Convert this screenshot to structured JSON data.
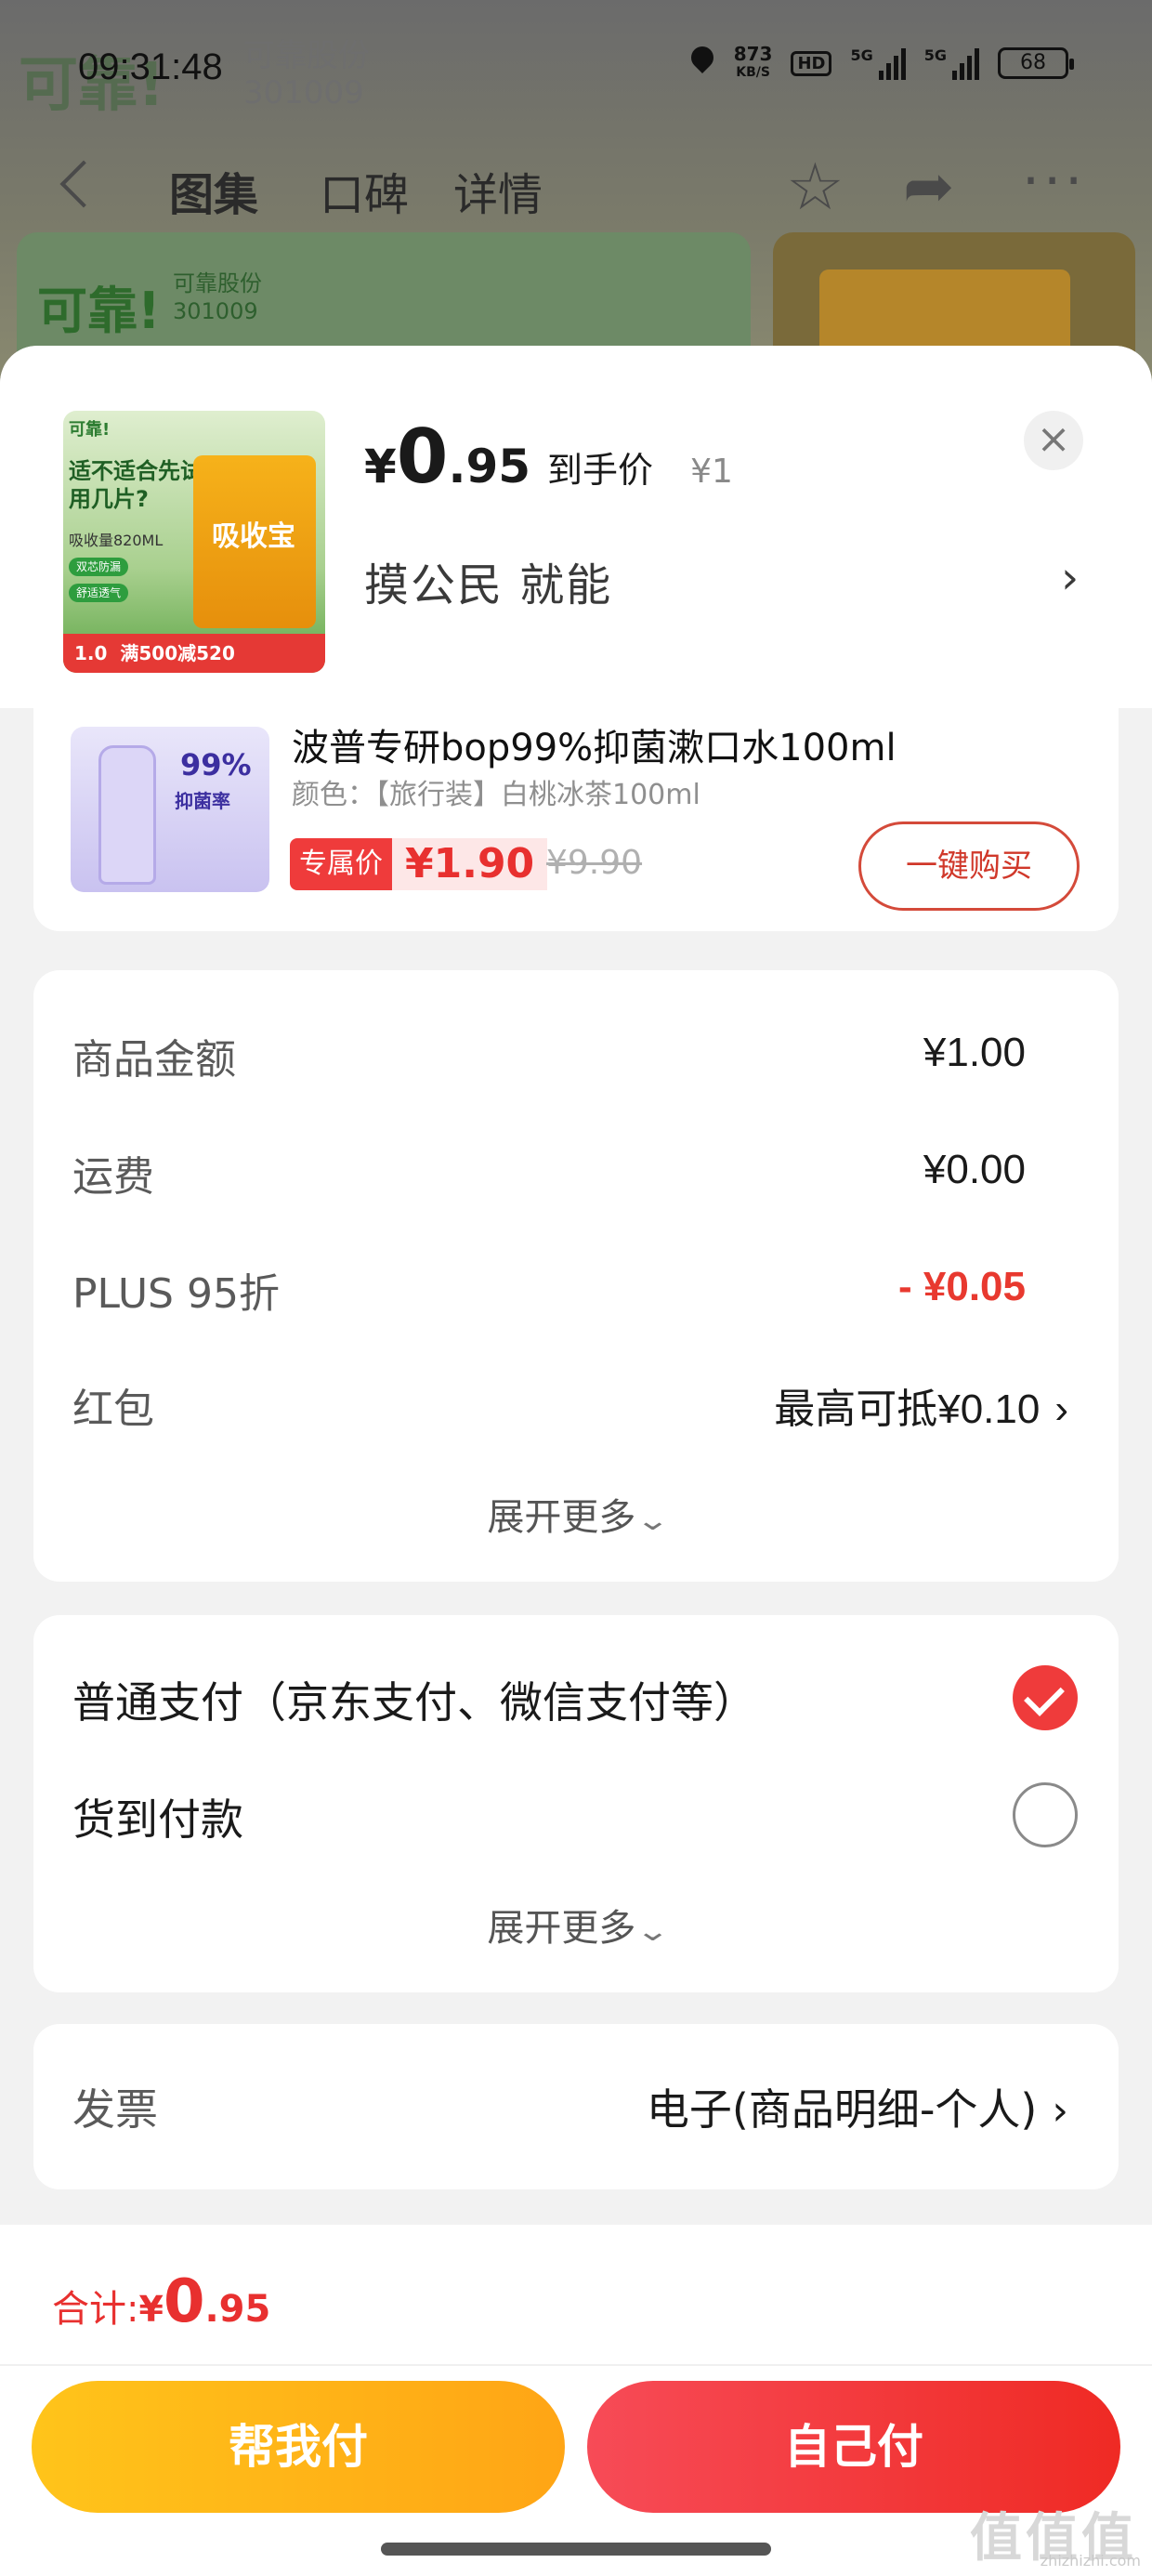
{
  "status_bar": {
    "time": "09:31:48",
    "net_speed_value": "873",
    "net_speed_unit": "KB/S",
    "hd": "HD",
    "signal_1": "5G",
    "signal_2": "5G",
    "battery": "68"
  },
  "background": {
    "brand_logo": "可靠!",
    "brand_name": "可靠股份",
    "brand_code": "301009"
  },
  "nav": {
    "tabs": [
      {
        "label": "图集",
        "active": true
      },
      {
        "label": "口碑",
        "active": false
      },
      {
        "label": "详情",
        "active": false
      }
    ],
    "icons": [
      "back-icon",
      "star-icon",
      "share-icon",
      "more-icon"
    ]
  },
  "sheet": {
    "product_thumb": {
      "logo": "可靠!",
      "headline": "适不适合先试用几片?",
      "capacity": "吸收量820ML",
      "tags": [
        "双芯防漏",
        "舒适透气"
      ],
      "package_brand": "吸收宝",
      "footer_price": "1.0",
      "footer_promo": "满500减520"
    },
    "price": {
      "currency": "¥",
      "integer": "0",
      "decimal": ".95",
      "label": "到手价",
      "original": "¥1"
    },
    "promo_text": "摸公民  就能",
    "close_icon": "×"
  },
  "item": {
    "title": "波普专研bop99%抑菌漱口水100ml",
    "spec": "颜色：【旅行装】白桃冰茶100ml",
    "image_text_pct": "99%",
    "image_text_sub": "抑菌率",
    "exclusive_tag": "专属价",
    "exclusive_price": "¥1.90",
    "original_price": "¥9.90",
    "buy_button": "一键购买"
  },
  "amounts": {
    "rows": [
      {
        "label": "商品金额",
        "value": "¥1.00"
      },
      {
        "label": "运费",
        "value": "¥0.00"
      },
      {
        "label": "PLUS 95折",
        "value": "- ¥0.05"
      },
      {
        "label": "红包",
        "value": "最高可抵¥0.10"
      }
    ],
    "expand": "展开更多"
  },
  "payment": {
    "options": [
      {
        "label": "普通支付（京东支付、微信支付等）",
        "selected": true
      },
      {
        "label": "货到付款",
        "selected": false
      }
    ],
    "expand": "展开更多"
  },
  "invoice": {
    "label": "发票",
    "value": "电子(商品明细-个人)"
  },
  "footer": {
    "total_label": "合计:",
    "total_currency": "¥",
    "total_integer": "0",
    "total_decimal": ".95",
    "help_pay": "帮我付",
    "self_pay": "自己付",
    "watermark": "值值值",
    "watermark_url": "zhizhizhi.com"
  },
  "colors": {
    "accent_red": "#ef3b3b",
    "price_red": "#e8302f",
    "help_yellow": "#ffb417"
  }
}
